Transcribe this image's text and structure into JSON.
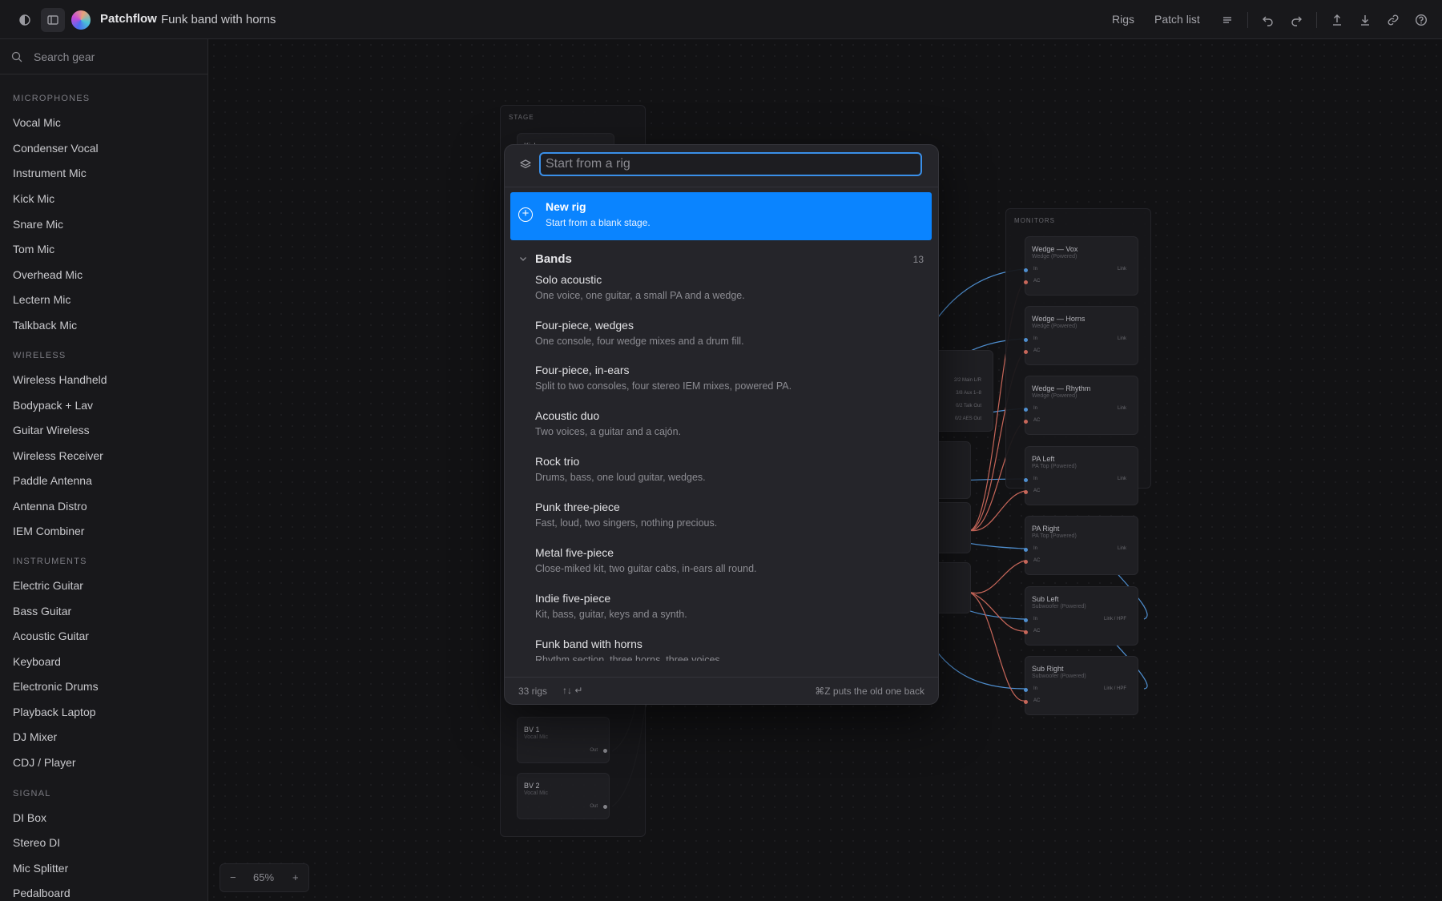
{
  "topbar": {
    "app_name": "Patchflow",
    "document_name": "Funk band with horns",
    "links": [
      "Rigs",
      "Patch list"
    ],
    "icons": [
      "theme-toggle-icon",
      "sidebar-toggle-icon",
      "menu-icon",
      "undo-icon",
      "redo-icon",
      "upload-icon",
      "download-icon",
      "link-icon",
      "help-icon"
    ]
  },
  "sidebar": {
    "search_placeholder": "Search gear",
    "sections": [
      {
        "title": "MICROPHONES",
        "items": [
          "Vocal Mic",
          "Condenser Vocal",
          "Instrument Mic",
          "Kick Mic",
          "Snare Mic",
          "Tom Mic",
          "Overhead Mic",
          "Lectern Mic",
          "Talkback Mic"
        ]
      },
      {
        "title": "WIRELESS",
        "items": [
          "Wireless Handheld",
          "Bodypack + Lav",
          "Guitar Wireless",
          "Wireless Receiver",
          "Paddle Antenna",
          "Antenna Distro",
          "IEM Combiner"
        ]
      },
      {
        "title": "INSTRUMENTS",
        "items": [
          "Electric Guitar",
          "Bass Guitar",
          "Acoustic Guitar",
          "Keyboard",
          "Electronic Drums",
          "Playback Laptop",
          "DJ Mixer",
          "CDJ / Player"
        ]
      },
      {
        "title": "SIGNAL",
        "items": [
          "DI Box",
          "Stereo DI",
          "Mic Splitter",
          "Pedalboard"
        ]
      }
    ]
  },
  "canvas": {
    "stage_title": "STAGE",
    "stage_nodes": [
      {
        "name": "Kick",
        "sub": "",
        "port": ""
      },
      {
        "name": "BV 1",
        "sub": "Vocal Mic",
        "port": "Out"
      },
      {
        "name": "BV 2",
        "sub": "Vocal Mic",
        "port": "Out"
      }
    ],
    "monitors_title": "MONITORS",
    "monitor_nodes": [
      {
        "name": "Wedge — Vox",
        "sub": "Wedge (Powered)",
        "in": "In",
        "ac": "AC",
        "out": "Link"
      },
      {
        "name": "Wedge — Horns",
        "sub": "Wedge (Powered)",
        "in": "In",
        "ac": "AC",
        "out": "Link"
      },
      {
        "name": "Wedge — Rhythm",
        "sub": "Wedge (Powered)",
        "in": "In",
        "ac": "AC",
        "out": "Link"
      },
      {
        "name": "PA Left",
        "sub": "PA Top (Powered)",
        "in": "In",
        "ac": "AC",
        "out": "Link"
      },
      {
        "name": "PA Right",
        "sub": "PA Top (Powered)",
        "in": "In",
        "ac": "AC",
        "out": "Link"
      },
      {
        "name": "Sub Left",
        "sub": "Subwoofer (Powered)",
        "in": "In",
        "ac": "AC",
        "out": "Link / HPF"
      },
      {
        "name": "Sub Right",
        "sub": "Subwoofer (Powered)",
        "in": "In",
        "ac": "AC",
        "out": "Link / HPF"
      }
    ],
    "console_ports": [
      "2/2 Main L/R",
      "3/8 Aux 1–8",
      "0/2 Talk Out",
      "0/2 AES Out"
    ],
    "zoom": {
      "minus": "−",
      "level": "65%",
      "plus": "+"
    }
  },
  "modal": {
    "input_placeholder": "Start from a rig",
    "new_rig": {
      "title": "New rig",
      "subtitle": "Start from a blank stage."
    },
    "group": {
      "name": "Bands",
      "count": "13"
    },
    "rigs": [
      {
        "name": "Solo acoustic",
        "desc": "One voice, one guitar, a small PA and a wedge."
      },
      {
        "name": "Four-piece, wedges",
        "desc": "One console, four wedge mixes and a drum fill."
      },
      {
        "name": "Four-piece, in-ears",
        "desc": "Split to two consoles, four stereo IEM mixes, powered PA."
      },
      {
        "name": "Acoustic duo",
        "desc": "Two voices, a guitar and a cajón."
      },
      {
        "name": "Rock trio",
        "desc": "Drums, bass, one loud guitar, wedges."
      },
      {
        "name": "Punk three-piece",
        "desc": "Fast, loud, two singers, nothing precious."
      },
      {
        "name": "Metal five-piece",
        "desc": "Close-miked kit, two guitar cabs, in-ears all round."
      },
      {
        "name": "Indie five-piece",
        "desc": "Kit, bass, guitar, keys and a synth."
      },
      {
        "name": "Funk band with horns",
        "desc": "Rhythm section, three horns, three voices."
      }
    ],
    "footer": {
      "count": "33 rigs",
      "keys": "↑↓ ↵",
      "hint": "⌘Z puts the old one back"
    }
  },
  "colors": {
    "accent": "#0a84ff",
    "focus_ring": "#3a8fe8",
    "port_blue": "#4f8fd0",
    "port_red": "#c8675a"
  }
}
